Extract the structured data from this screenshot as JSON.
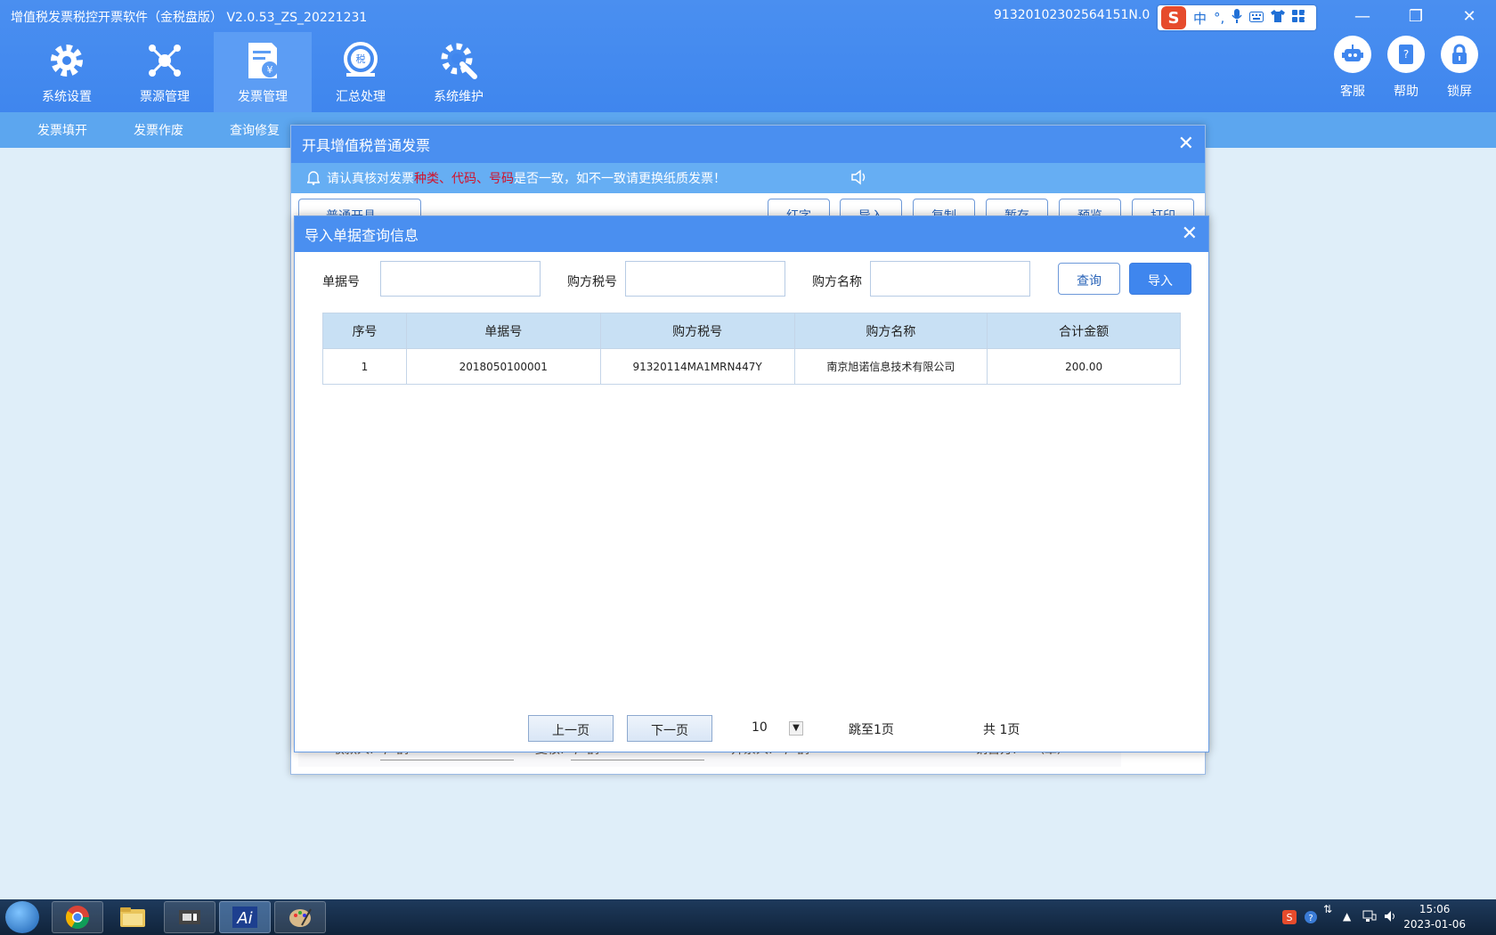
{
  "app": {
    "title": "增值税发票税控开票软件（金税盘版） V2.0.53_ZS_20221231",
    "tax_id": "91320102302564151N.0"
  },
  "ime": {
    "logo": "S",
    "lang": "中",
    "punct": "°,"
  },
  "window_controls": [
    "≡",
    "—",
    "❐",
    "✕"
  ],
  "nav": {
    "items": [
      {
        "label": "系统设置",
        "icon": "gear-icon"
      },
      {
        "label": "票源管理",
        "icon": "network-icon"
      },
      {
        "label": "发票管理",
        "icon": "invoice-icon"
      },
      {
        "label": "汇总处理",
        "icon": "tax-stamp-icon"
      },
      {
        "label": "系统维护",
        "icon": "wrench-gear-icon"
      }
    ],
    "right_tools": [
      {
        "label": "客服",
        "icon": "robot-icon"
      },
      {
        "label": "帮助",
        "icon": "help-book-icon"
      },
      {
        "label": "锁屏",
        "icon": "lock-icon"
      }
    ]
  },
  "sub_nav": {
    "items": [
      "发票填开",
      "发票作废",
      "查询修复"
    ]
  },
  "invoice_dialog": {
    "title": "开具增值税普通发票",
    "notice_prefix": "请认真核对发票",
    "notice_highlight": "种类、代码、号码",
    "notice_suffix": "是否一致，如不一致请更换纸质发票！",
    "mode_select": "普通开具",
    "buttons": [
      "红字",
      "导入",
      "复制",
      "暂存",
      "预览",
      "打印"
    ],
    "footer": {
      "payee_label": "收款人:",
      "payee_value": "广鹊",
      "reviewer_label": "复核:",
      "reviewer_value": "广鹊",
      "issuer_label": "开票人:",
      "issuer_value": "广鹊",
      "seller_label": "销售方:",
      "seller_value": "（章）"
    }
  },
  "import_dialog": {
    "title": "导入单据查询信息",
    "fields": {
      "doc_no_label": "单据号",
      "doc_no_value": "",
      "buyer_tax_label": "购方税号",
      "buyer_tax_value": "",
      "buyer_name_label": "购方名称",
      "buyer_name_value": ""
    },
    "query_button": "查询",
    "import_button": "导入",
    "table": {
      "headers": [
        "序号",
        "单据号",
        "购方税号",
        "购方名称",
        "合计金额"
      ],
      "rows": [
        [
          "1",
          "2018050100001",
          "91320114MA1MRN447Y",
          "南京旭诺信息技术有限公司",
          "200.00"
        ]
      ]
    },
    "pager": {
      "prev": "上一页",
      "next": "下一页",
      "page_size": "10",
      "jump": "跳至1页",
      "total": "共 1页"
    }
  },
  "taskbar": {
    "clock_time": "15:06",
    "clock_date": "2023-01-06"
  }
}
